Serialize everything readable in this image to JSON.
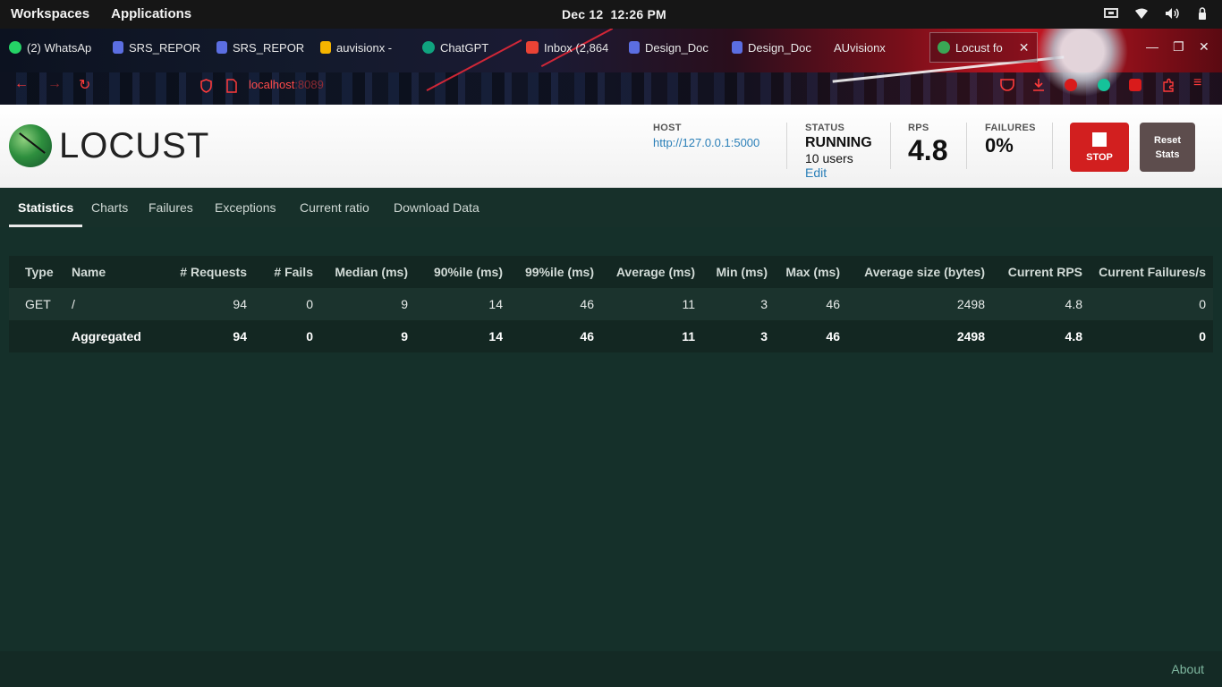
{
  "os": {
    "workspaces": "Workspaces",
    "applications": "Applications",
    "date": "Dec 12",
    "time": "12:26 PM"
  },
  "browser": {
    "tabs": [
      {
        "label": "(2) WhatsAp",
        "color": "#25d366"
      },
      {
        "label": "SRS_REPOR",
        "color": "#5b6ee1"
      },
      {
        "label": "SRS_REPOR",
        "color": "#5b6ee1"
      },
      {
        "label": "auvisionx -",
        "color": "#f5b400"
      },
      {
        "label": "ChatGPT",
        "color": "#10a37f"
      },
      {
        "label": "Inbox (2,864",
        "color": "#ea4335"
      },
      {
        "label": "Design_Doc",
        "color": "#5b6ee1"
      },
      {
        "label": "Design_Doc",
        "color": "#5b6ee1"
      },
      {
        "label": "AUvisionx",
        "color": "#000000"
      },
      {
        "label": "Locust fo",
        "color": "#3aa655"
      }
    ],
    "url_host": "localhost",
    "url_port": ":8089"
  },
  "header": {
    "logo_text": "LOCUST",
    "host_label": "HOST",
    "host_value": "http://127.0.0.1:5000",
    "status_label": "STATUS",
    "status_value": "RUNNING",
    "users": "10 users",
    "edit": "Edit",
    "rps_label": "RPS",
    "rps_value": "4.8",
    "failures_label": "FAILURES",
    "failures_value": "0%",
    "stop": "STOP",
    "reset_line1": "Reset",
    "reset_line2": "Stats"
  },
  "nav": {
    "tabs": [
      "Statistics",
      "Charts",
      "Failures",
      "Exceptions",
      "Current ratio",
      "Download Data"
    ]
  },
  "table": {
    "headers": [
      "Type",
      "Name",
      "# Requests",
      "# Fails",
      "Median (ms)",
      "90%ile (ms)",
      "99%ile (ms)",
      "Average (ms)",
      "Min (ms)",
      "Max (ms)",
      "Average size (bytes)",
      "Current RPS",
      "Current Failures/s"
    ],
    "rows": [
      [
        "GET",
        "/",
        "94",
        "0",
        "9",
        "14",
        "46",
        "11",
        "3",
        "46",
        "2498",
        "4.8",
        "0"
      ]
    ],
    "aggregated": [
      "",
      "Aggregated",
      "94",
      "0",
      "9",
      "14",
      "46",
      "11",
      "3",
      "46",
      "2498",
      "4.8",
      "0"
    ]
  },
  "footer": {
    "about": "About"
  }
}
